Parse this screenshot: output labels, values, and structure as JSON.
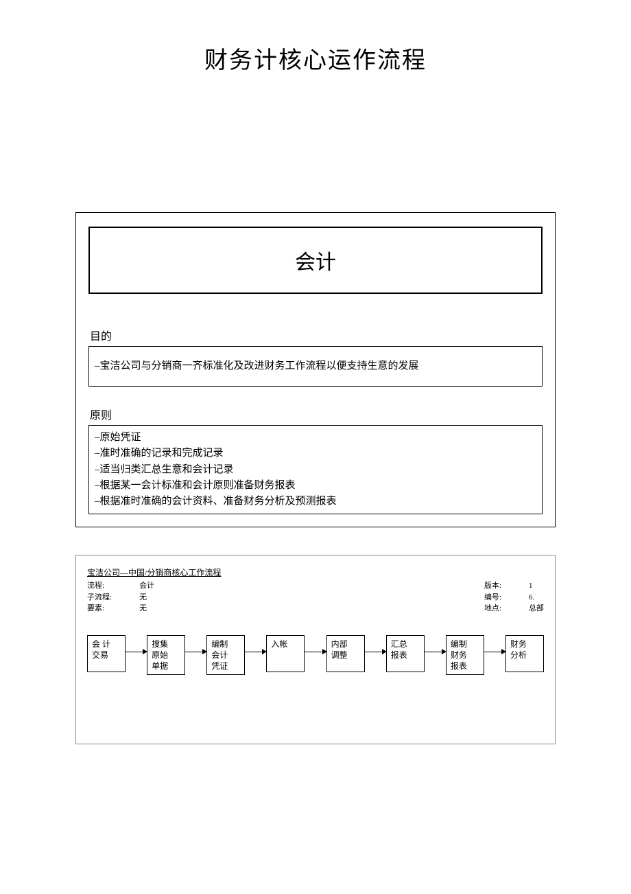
{
  "title": "财务计核心运作流程",
  "section1": {
    "header": "会计",
    "purposeLabel": "目的",
    "purpose": "–宝洁公司与分销商一齐标准化及改进财务工作流程以便支持生意的发展",
    "principlesLabel": "原则",
    "principles": [
      "–原始凭证",
      "–准时准确的记录和完成记录",
      "–适当归类汇总生意和会计记录",
      "–根据某一会计标准和会计原则准备财务报表",
      "–根据准时准确的会计资料、准备财务分析及预测报表"
    ]
  },
  "flow": {
    "title": "宝洁公司—中国/分销商核心工作流程",
    "meta_left": [
      {
        "label": "流程:",
        "value": "会计"
      },
      {
        "label": "子流程:",
        "value": "无"
      },
      {
        "label": "要素:",
        "value": "无"
      }
    ],
    "meta_right": [
      {
        "label": "版本:",
        "value": "1"
      },
      {
        "label": "编号:",
        "value": "6."
      },
      {
        "label": "地点:",
        "value": "总部"
      }
    ],
    "steps": [
      "会 计\n交易",
      "搜集\n原始\n单据",
      "编制\n会计\n凭证",
      "入帐",
      "内部\n调整",
      "汇总\n报表",
      "编制\n财务\n报表",
      "财务\n分析"
    ]
  }
}
